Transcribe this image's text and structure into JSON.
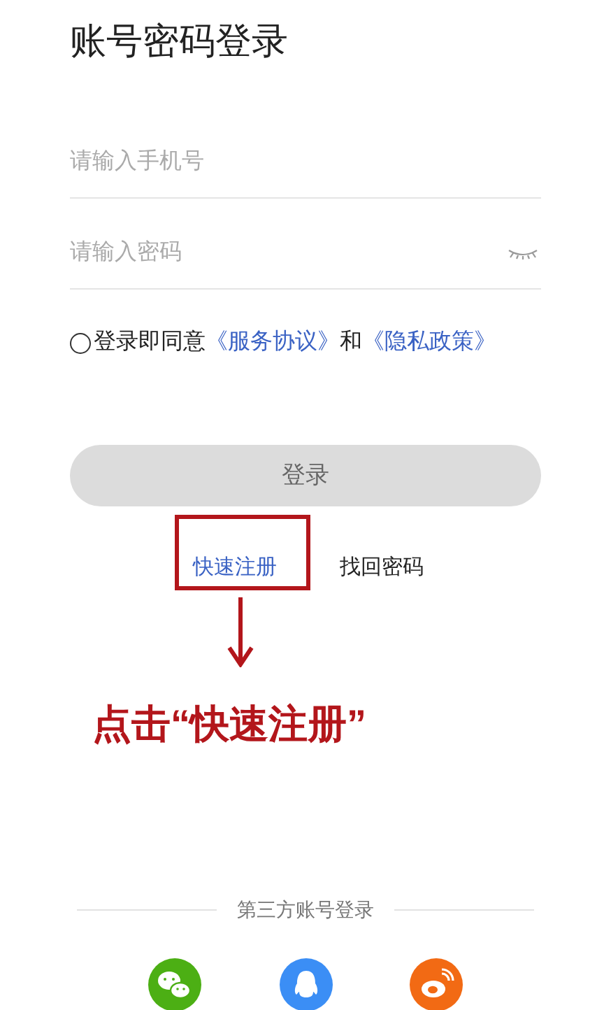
{
  "title": "账号密码登录",
  "phone_field": {
    "placeholder": "请输入手机号"
  },
  "password_field": {
    "placeholder": "请输入密码",
    "password_visible": false
  },
  "agreement": {
    "checked": false,
    "prefix": "登录即同意",
    "terms_link": "《服务协议》",
    "joiner": "和",
    "privacy_link": "《隐私政策》"
  },
  "login_button": {
    "label": "登录",
    "disabled": true
  },
  "links": [
    {
      "label": "快速注册",
      "highlighted": true
    },
    {
      "label": "找回密码",
      "highlighted": false
    }
  ],
  "annotation": {
    "label": "点击“快速注册”"
  },
  "third_party": {
    "label": "第三方账号登录",
    "providers": [
      {
        "kind": "bubbles",
        "color": "#4caf14"
      },
      {
        "kind": "penguin",
        "color": "#3b8ef5"
      },
      {
        "kind": "swirl",
        "color": "#f26a14"
      }
    ]
  }
}
